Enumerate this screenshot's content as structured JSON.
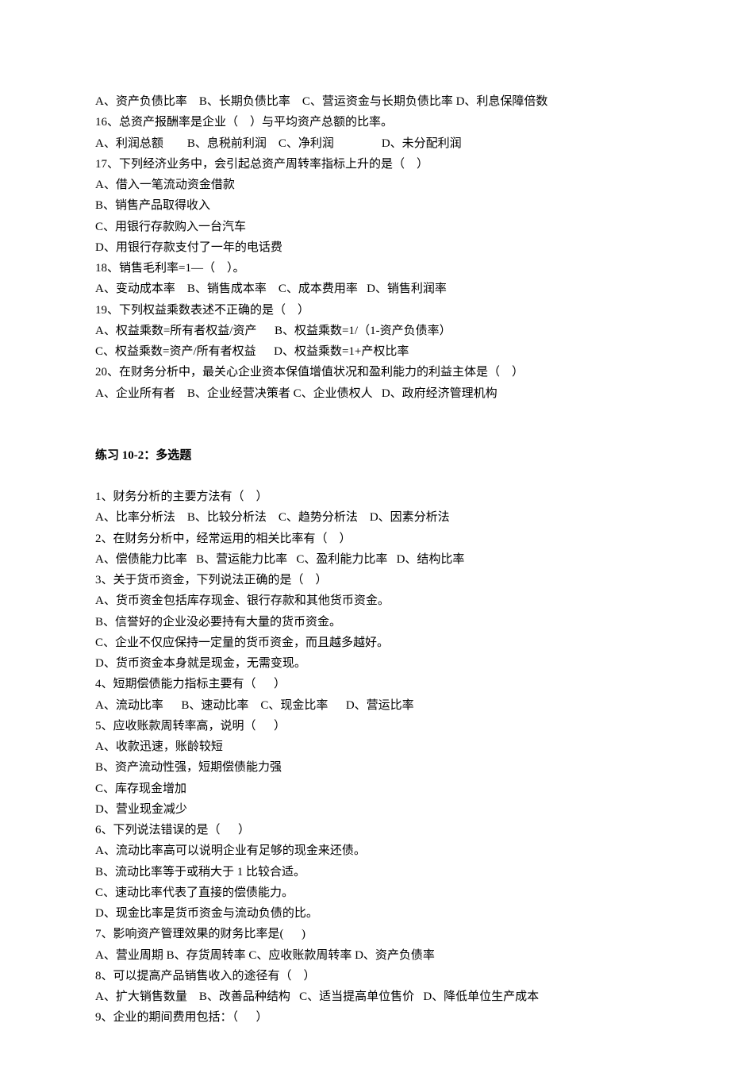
{
  "lines": [
    "A、资产负债比率    B、长期负债比率    C、营运资金与长期负债比率 D、利息保障倍数",
    "16、总资产报酬率是企业（    ）与平均资产总额的比率。",
    "A、利润总额        B、息税前利润    C、净利润                D、未分配利润",
    "17、下列经济业务中，会引起总资产周转率指标上升的是（    ）",
    "A、借入一笔流动资金借款",
    "B、销售产品取得收入",
    "C、用银行存款购入一台汽车",
    "D、用银行存款支付了一年的电话费",
    "18、销售毛利率=1—（    ）。",
    "A、变动成本率    B、销售成本率    C、成本费用率   D、销售利润率",
    "19、下列权益乘数表述不正确的是（    ）",
    "A、权益乘数=所有者权益/资产      B、权益乘数=1/（1-资产负债率）",
    "C、权益乘数=资产/所有者权益      D、权益乘数=1+产权比率",
    "20、在财务分析中，最关心企业资本保值增值状况和盈利能力的利益主体是（    ）",
    "A、企业所有者    B、企业经营决策者 C、企业债权人   D、政府经济管理机构"
  ],
  "section_title": "练习 10-2：多选题",
  "lines2": [
    "1、财务分析的主要方法有（    ）",
    "A、比率分析法    B、比较分析法    C、趋势分析法    D、因素分析法",
    "2、在财务分析中，经常运用的相关比率有（    ）",
    "A、偿债能力比率   B、营运能力比率   C、盈利能力比率   D、结构比率",
    "3、关于货币资金，下列说法正确的是（    ）",
    "A、货币资金包括库存现金、银行存款和其他货币资金。",
    "B、信誉好的企业没必要持有大量的货币资金。",
    "C、企业不仅应保持一定量的货币资金，而且越多越好。",
    "D、货币资金本身就是现金，无需变现。",
    "4、短期偿债能力指标主要有（      ）",
    "A、流动比率      B、速动比率    C、现金比率      D、营运比率",
    "5、应收账款周转率高，说明（      ）",
    "A、收款迅速，账龄较短",
    "B、资产流动性强，短期偿债能力强",
    "C、库存现金增加",
    "D、营业现金减少",
    "6、下列说法错误的是（      ）",
    "A、流动比率高可以说明企业有足够的现金来还债。",
    "B、流动比率等于或稍大于 1 比较合适。",
    "C、速动比率代表了直接的偿债能力。",
    "D、现金比率是货币资金与流动负债的比。",
    "7、影响资产管理效果的财务比率是(      )",
    "A、营业周期 B、存货周转率 C、应收账款周转率 D、资产负债率",
    "8、可以提高产品销售收入的途径有（    ）",
    "A、扩大销售数量    B、改善品种结构   C、适当提高单位售价   D、降低单位生产成本",
    "9、企业的期间费用包括：（      ）"
  ]
}
